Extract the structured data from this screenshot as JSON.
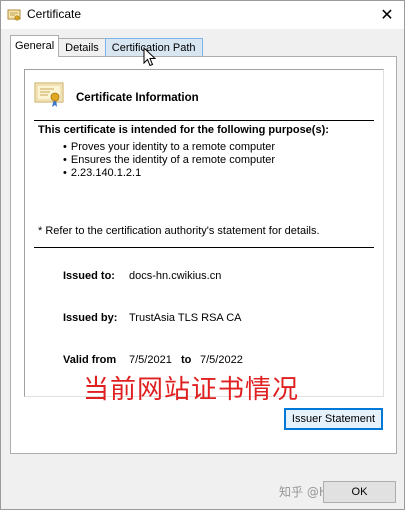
{
  "window": {
    "title": "Certificate",
    "icon": "certificate-icon",
    "close_glyph": "✕"
  },
  "tabs": [
    {
      "label": "General",
      "active": true
    },
    {
      "label": "Details",
      "active": false
    },
    {
      "label": "Certification Path",
      "active": false,
      "hover": true
    }
  ],
  "cert": {
    "info_title": "Certificate Information",
    "purpose_heading": "This certificate is intended for the following purpose(s):",
    "purposes": [
      "Proves your identity to a remote computer",
      "Ensures the identity of a remote computer",
      "2.23.140.1.2.1"
    ],
    "refer_note": "* Refer to the certification authority's statement for details.",
    "issued_to_label": "Issued to:",
    "issued_to_value": "docs-hn.cwikius.cn",
    "issued_by_label": "Issued by:",
    "issued_by_value": "TrustAsia TLS RSA CA",
    "valid_from_label": "Valid from",
    "valid_from_value": "7/5/2021",
    "valid_to_label": "to",
    "valid_to_value": "7/5/2022"
  },
  "buttons": {
    "issuer_statement": "Issuer Statement",
    "ok": "OK"
  },
  "annotation_text": "当前网站证书情况",
  "watermark": "知乎 @HoneyMoose",
  "colors": {
    "annotation": "#e02020",
    "focus_border": "#0078d7",
    "tab_hover": "#d8e6f2"
  }
}
